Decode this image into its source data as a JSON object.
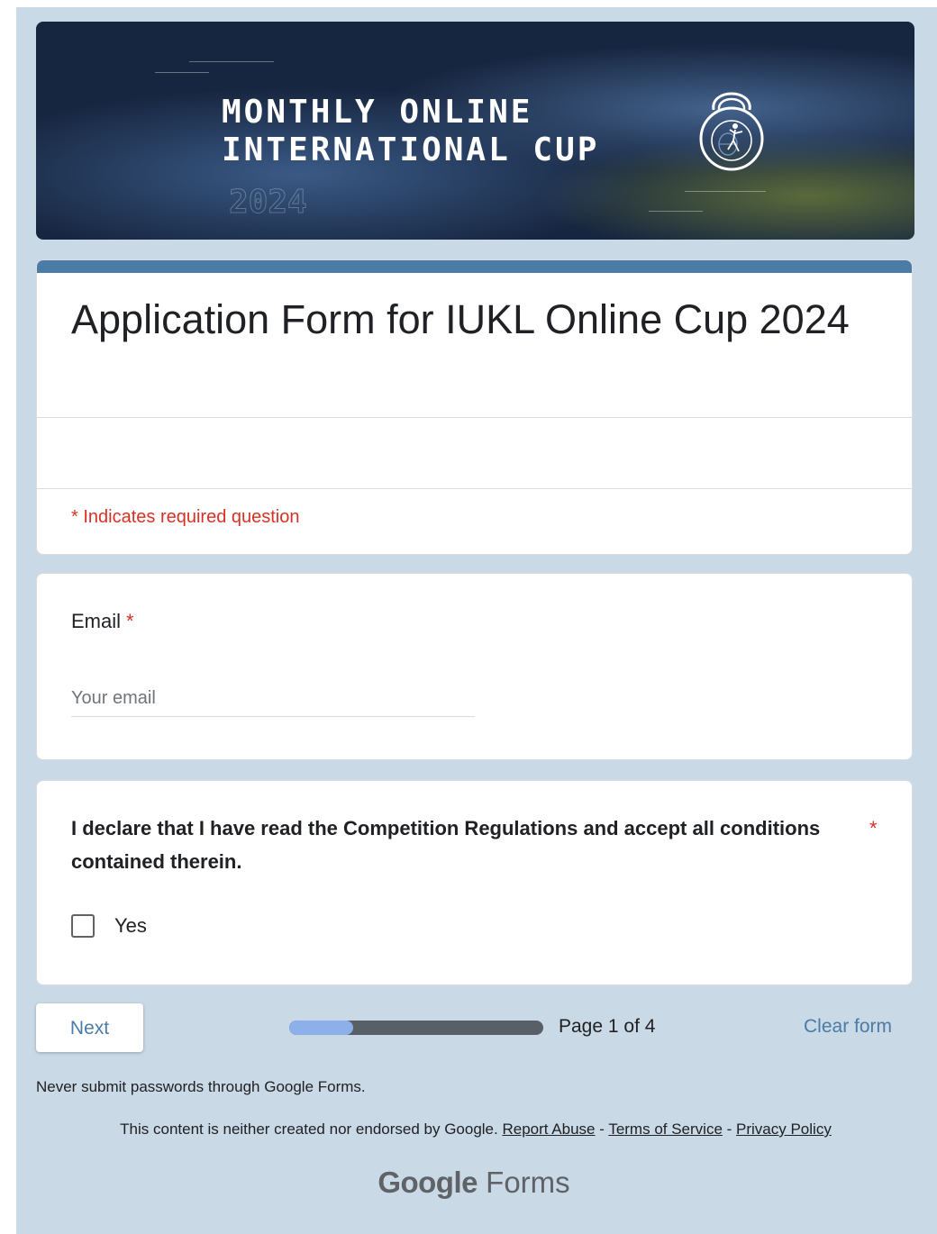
{
  "banner": {
    "line1": "MONTHLY ONLINE",
    "line2": "INTERNATIONAL CUP",
    "year": "2024",
    "logo_icon": "kettlebell-globe-icon"
  },
  "form": {
    "title": "Application Form for IUKL Online Cup 2024",
    "required_note": "* Indicates required question"
  },
  "questions": {
    "email": {
      "label": "Email",
      "required_mark": "*",
      "placeholder": "Your email"
    },
    "declaration": {
      "text": "I declare that I have read the Competition Regulations and accept all conditions contained therein.",
      "required_mark": "*",
      "option_label": "Yes",
      "checked": false
    }
  },
  "navigation": {
    "next_label": "Next",
    "page_indicator": "Page 1 of 4",
    "progress_fraction": 0.25,
    "clear_label": "Clear form"
  },
  "footer": {
    "warning": "Never submit passwords through Google Forms.",
    "disclaimer": "This content is neither created nor endorsed by Google.",
    "report_abuse": "Report Abuse",
    "separator": " - ",
    "terms": "Terms of Service",
    "privacy": "Privacy Policy",
    "brand_google": "Google",
    "brand_forms": "Forms"
  },
  "colors": {
    "page_background": "#c9d9e6",
    "accent": "#4b7ba7",
    "required_red": "#d93025",
    "banner_background": "#172640"
  }
}
